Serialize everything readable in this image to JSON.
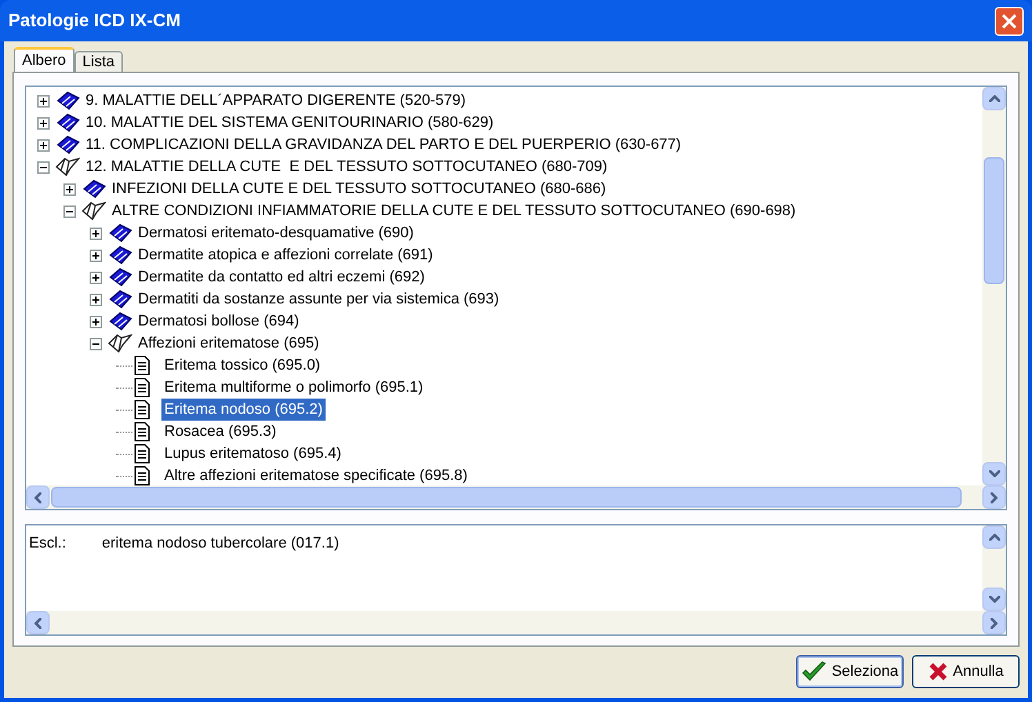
{
  "window": {
    "title": "Patologie ICD IX-CM"
  },
  "tabs": [
    {
      "label": "Albero",
      "selected": true
    },
    {
      "label": "Lista",
      "selected": false
    }
  ],
  "tree": [
    {
      "kind": "book",
      "label": "9. MALATTIE DELL´APPARATO DIGERENTE (520-579)",
      "expanded": false,
      "selected": false
    },
    {
      "kind": "book",
      "label": "10. MALATTIE DEL SISTEMA GENITOURINARIO (580-629)",
      "expanded": false,
      "selected": false
    },
    {
      "kind": "book",
      "label": "11. COMPLICAZIONI DELLA GRAVIDANZA DEL PARTO E DEL PUERPERIO (630-677)",
      "expanded": false,
      "selected": false
    },
    {
      "kind": "book",
      "label": "12. MALATTIE DELLA CUTE  E DEL TESSUTO SOTTOCUTANEO (680-709)",
      "expanded": true,
      "selected": false,
      "children": [
        {
          "kind": "book",
          "label": "INFEZIONI DELLA CUTE E DEL TESSUTO SOTTOCUTANEO (680-686)",
          "expanded": false,
          "selected": false
        },
        {
          "kind": "book",
          "label": "ALTRE CONDIZIONI INFIAMMATORIE DELLA CUTE E DEL TESSUTO SOTTOCUTANEO (690-698)",
          "expanded": true,
          "selected": false,
          "children": [
            {
              "kind": "book",
              "label": "Dermatosi eritemato-desquamative (690)",
              "expanded": false,
              "selected": false
            },
            {
              "kind": "book",
              "label": "Dermatite atopica e affezioni correlate (691)",
              "expanded": false,
              "selected": false
            },
            {
              "kind": "book",
              "label": "Dermatite da contatto ed altri eczemi (692)",
              "expanded": false,
              "selected": false
            },
            {
              "kind": "book",
              "label": "Dermatiti da sostanze assunte per via sistemica (693)",
              "expanded": false,
              "selected": false
            },
            {
              "kind": "book",
              "label": "Dermatosi bollose (694)",
              "expanded": false,
              "selected": false
            },
            {
              "kind": "book",
              "label": "Affezioni eritematose (695)",
              "expanded": true,
              "selected": false,
              "children": [
                {
                  "kind": "page",
                  "label": "Eritema tossico (695.0)",
                  "selected": false
                },
                {
                  "kind": "page",
                  "label": "Eritema multiforme o polimorfo (695.1)",
                  "selected": false
                },
                {
                  "kind": "page",
                  "label": "Eritema nodoso (695.2)",
                  "selected": true
                },
                {
                  "kind": "page",
                  "label": "Rosacea (695.3)",
                  "selected": false
                },
                {
                  "kind": "page",
                  "label": "Lupus eritematoso (695.4)",
                  "selected": false
                },
                {
                  "kind": "page",
                  "label": "Altre affezioni eritematose specificate (695.8)",
                  "selected": false
                }
              ]
            }
          ]
        }
      ]
    }
  ],
  "note": {
    "label": "Escl.:",
    "text": "eritema nodoso tubercolare (017.1)"
  },
  "buttons": [
    {
      "kind": "ok",
      "label": "Seleziona"
    },
    {
      "kind": "cancel",
      "label": "Annulla"
    }
  ]
}
